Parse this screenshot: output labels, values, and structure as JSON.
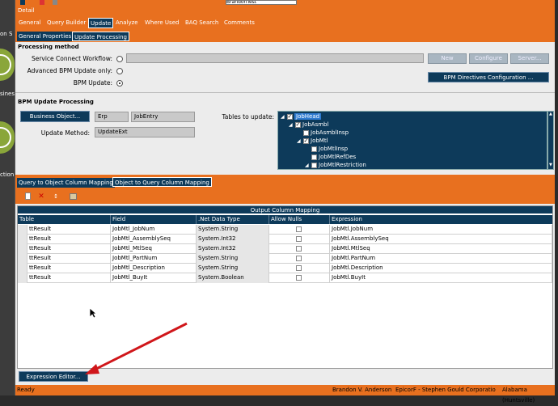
{
  "window": {
    "top_input_value": "BrandonTest",
    "detail_label": "Detail"
  },
  "left_panel": {
    "texts": [
      "on S",
      "siness",
      "ction"
    ]
  },
  "tabs": [
    "General",
    "Query Builder",
    "Update",
    "Analyze",
    "Where Used",
    "BAQ Search",
    "Comments"
  ],
  "subtabs": [
    "General Properties",
    "Update Processing"
  ],
  "processing": {
    "heading": "Processing method",
    "service_connect_label": "Service Connect Workflow:",
    "advanced_bpm_label": "Advanced BPM Update only:",
    "bpm_update_label": "BPM Update:",
    "btn_new": "New",
    "btn_configure": "Configure",
    "btn_server": "Server...",
    "btn_bpm_directives": "BPM Directives Configuration ..."
  },
  "bpm": {
    "heading": "BPM Update Processing",
    "business_object_btn": "Business Object...",
    "bo_field1": "Erp",
    "bo_field2": "JobEntry",
    "update_method_label": "Update Method:",
    "update_method_value": "UpdateExt",
    "tables_label": "Tables to update:",
    "tree": [
      {
        "label": "JobHead",
        "checked": true,
        "expander": "◢",
        "selected": true
      },
      {
        "label": "JobAsmbl",
        "checked": true,
        "expander": "◢"
      },
      {
        "label": "JobAsmblInsp",
        "checked": false,
        "expander": ""
      },
      {
        "label": "JobMtl",
        "checked": true,
        "expander": "◢"
      },
      {
        "label": "JobMtlInsp",
        "checked": false,
        "expander": ""
      },
      {
        "label": "JobMtlRefDes",
        "checked": false,
        "expander": ""
      },
      {
        "label": "JobMtlRestriction",
        "checked": false,
        "expander": "◢"
      }
    ]
  },
  "mapping_tabs": [
    "Query to Object Column Mapping",
    "Object to Query Column Mapping"
  ],
  "grid": {
    "title": "Output Column Mapping",
    "columns": [
      "Table",
      "Field",
      ".Net Data Type",
      "Allow Nulls",
      "Expression"
    ],
    "rows": [
      {
        "table": "ttResult",
        "field": "JobMtl_JobNum",
        "type": "System.String",
        "allow_nulls": false,
        "expression": "JobMtl.JobNum"
      },
      {
        "table": "ttResult",
        "field": "JobMtl_AssemblySeq",
        "type": "System.Int32",
        "allow_nulls": false,
        "expression": "JobMtl.AssemblySeq"
      },
      {
        "table": "ttResult",
        "field": "JobMtl_MtlSeq",
        "type": "System.Int32",
        "allow_nulls": false,
        "expression": "JobMtl.MtlSeq"
      },
      {
        "table": "ttResult",
        "field": "JobMtl_PartNum",
        "type": "System.String",
        "allow_nulls": false,
        "expression": "JobMtl.PartNum"
      },
      {
        "table": "ttResult",
        "field": "JobMtl_Description",
        "type": "System.String",
        "allow_nulls": false,
        "expression": "JobMtl.Description"
      },
      {
        "table": "ttResult",
        "field": "JobMtl_BuyIt",
        "type": "System.Boolean",
        "allow_nulls": false,
        "expression": "JobMtl.BuyIt"
      }
    ]
  },
  "expression_editor_btn": "Expression Editor...",
  "status": {
    "left": "Ready",
    "user": "Brandon V. Anderson",
    "company": "EpicorF - Stephen Gould Corporatio",
    "site": "Alabama (Huntsville)"
  },
  "colors": {
    "accent_orange": "#e8701f",
    "navy": "#0d3a5a",
    "arrow_red": "#d0161a"
  }
}
